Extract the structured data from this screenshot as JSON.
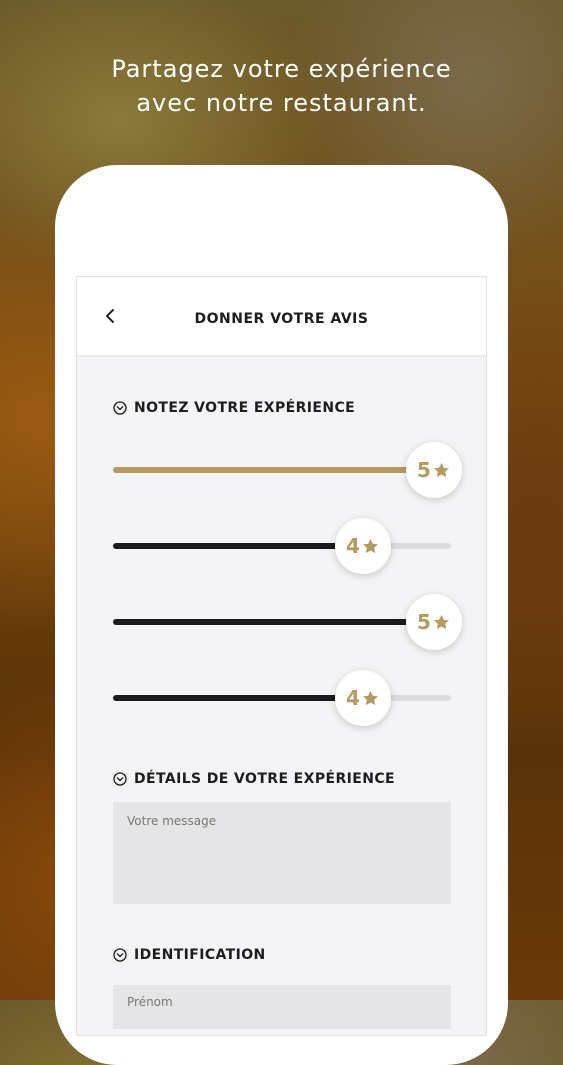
{
  "headline": {
    "line1": "Partagez votre expérience",
    "line2": "avec notre restaurant."
  },
  "appbar": {
    "back_icon": "chevron-left-icon",
    "title": "DONNER VOTRE AVIS"
  },
  "rating_section": {
    "icon": "chevron-down-circle-icon",
    "title": "NOTEZ VOTRE EXPÉRIENCE",
    "max": 5,
    "sliders": [
      {
        "value": 5,
        "label": "5",
        "active": true
      },
      {
        "value": 4,
        "label": "4",
        "active": false
      },
      {
        "value": 5,
        "label": "5",
        "active": false
      },
      {
        "value": 4,
        "label": "4",
        "active": false
      }
    ],
    "star_icon": "star-icon"
  },
  "details_section": {
    "icon": "chevron-down-circle-icon",
    "title": "DÉTAILS DE VOTRE EXPÉRIENCE",
    "message_placeholder": "Votre message"
  },
  "identification_section": {
    "icon": "chevron-down-circle-icon",
    "title": "IDENTIFICATION",
    "firstname_placeholder": "Prénom"
  },
  "colors": {
    "accent_gold": "#b8995e",
    "track_dark": "#1b1b1d",
    "track_empty": "#dcdcde"
  }
}
